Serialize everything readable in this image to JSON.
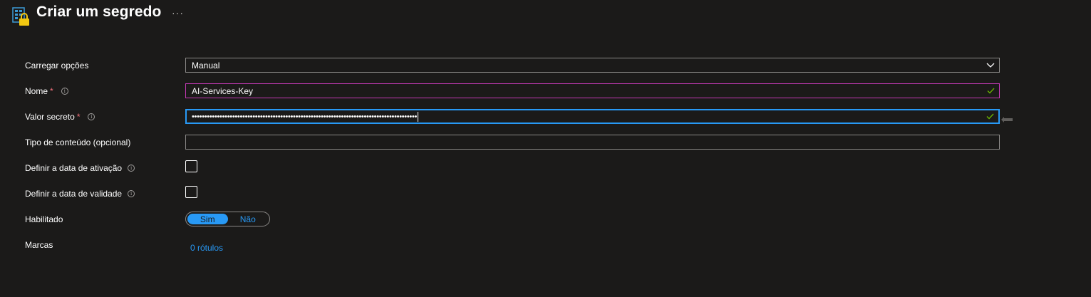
{
  "header": {
    "title": "Criar um segredo",
    "more": "···",
    "icon": "key-vault-secret-icon"
  },
  "form": {
    "upload_options": {
      "label": "Carregar opções",
      "value": "Manual"
    },
    "name": {
      "label": "Nome",
      "required_mark": "*",
      "value": "AI-Services-Key"
    },
    "secret_value": {
      "label": "Valor secreto",
      "required_mark": "*",
      "value": "•••••••••••••••••••••••••••••••••••••••••••••••••••••••••••••••••••••••••••••••••••••••••"
    },
    "content_type": {
      "label": "Tipo de conteúdo (opcional)",
      "value": ""
    },
    "activation_date": {
      "label": "Definir a data de ativação",
      "checked": false
    },
    "expiration_date": {
      "label": "Definir a data de validade",
      "checked": false
    },
    "enabled": {
      "label": "Habilitado",
      "options": [
        "Sim",
        "Não"
      ],
      "selected": "Sim"
    },
    "tags": {
      "label": "Marcas",
      "link": "0 rótulos"
    }
  },
  "colors": {
    "background": "#1b1a19",
    "accent": "#2899f5",
    "valid_check": "#6bb700",
    "required": "#f1707b",
    "name_border": "#c239b3"
  }
}
